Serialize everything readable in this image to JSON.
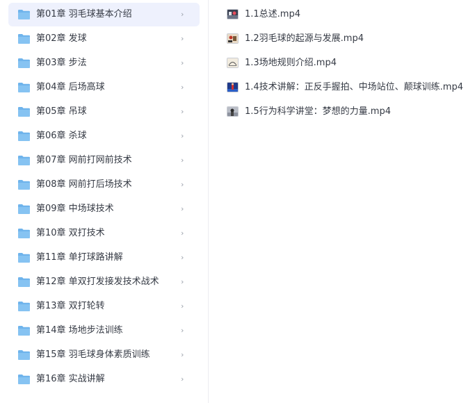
{
  "folders": [
    {
      "label": "第01章 羽毛球基本介绍",
      "selected": true
    },
    {
      "label": "第02章 发球"
    },
    {
      "label": "第03章 步法"
    },
    {
      "label": "第04章 后场高球"
    },
    {
      "label": "第05章 吊球"
    },
    {
      "label": "第06章 杀球"
    },
    {
      "label": "第07章 网前打网前技术"
    },
    {
      "label": "第08章 网前打后场技术"
    },
    {
      "label": "第09章 中场球技术"
    },
    {
      "label": "第10章 双打技术"
    },
    {
      "label": "第11章 单打球路讲解"
    },
    {
      "label": "第12章 单双打发接发技术战术"
    },
    {
      "label": "第13章 双打轮转"
    },
    {
      "label": "第14章 场地步法训练"
    },
    {
      "label": "第15章 羽毛球身体素质训练"
    },
    {
      "label": "第16章 实战讲解"
    }
  ],
  "chevron": "›",
  "files": [
    {
      "label": "1.1总述.mp4",
      "thumb_icon": "video-thumbnail-icon"
    },
    {
      "label": "1.2羽毛球的起源与发展.mp4",
      "thumb_icon": "video-thumbnail-icon"
    },
    {
      "label": "1.3场地规则介绍.mp4",
      "thumb_icon": "video-thumbnail-icon"
    },
    {
      "label": "1.4技术讲解：正反手握拍、中场站位、颠球训练.mp4",
      "thumb_icon": "video-thumbnail-icon"
    },
    {
      "label": "1.5行为科学讲堂：梦想的力量.mp4",
      "thumb_icon": "video-thumbnail-icon"
    }
  ],
  "colors": {
    "folder": "#6fb4ec",
    "selected_bg": "#eef1fd",
    "text": "#353a44"
  }
}
